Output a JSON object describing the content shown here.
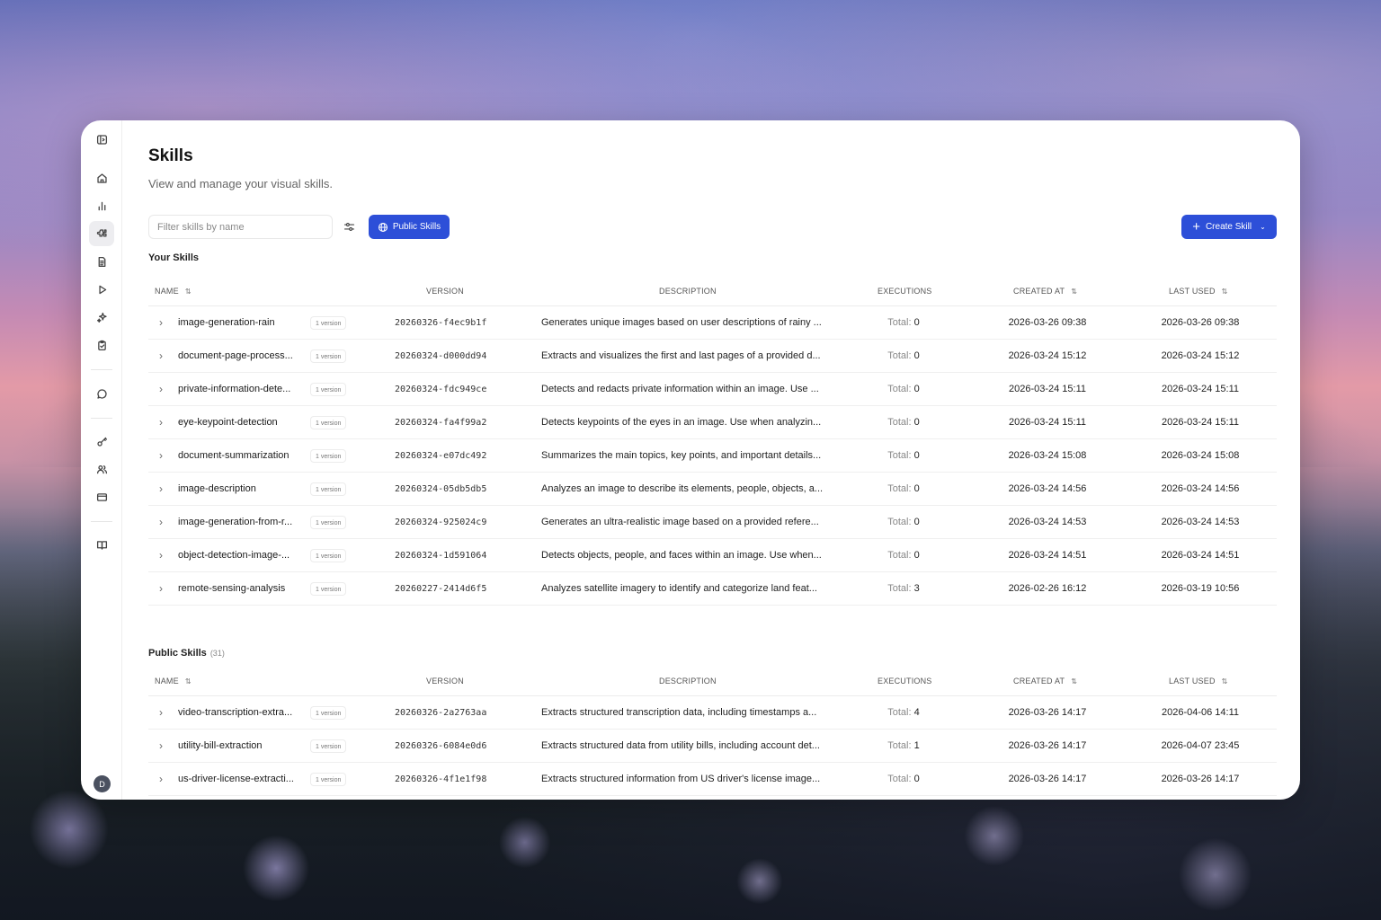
{
  "page": {
    "title": "Skills",
    "subtitle": "View and manage your visual skills."
  },
  "sidebar": {
    "items": [
      {
        "name": "sidebar-toggle",
        "icon": "panel-icon"
      },
      {
        "name": "home",
        "icon": "home-icon"
      },
      {
        "name": "analytics",
        "icon": "bar-chart-icon"
      },
      {
        "name": "skills",
        "icon": "puzzle-icon",
        "active": true
      },
      {
        "name": "documents",
        "icon": "document-icon"
      },
      {
        "name": "runs",
        "icon": "play-icon"
      },
      {
        "name": "sparkles",
        "icon": "sparkles-icon"
      },
      {
        "name": "tasks",
        "icon": "clipboard-icon"
      },
      {
        "name": "chat",
        "icon": "chat-icon"
      },
      {
        "name": "api-keys",
        "icon": "key-icon"
      },
      {
        "name": "team",
        "icon": "users-icon"
      },
      {
        "name": "billing",
        "icon": "credit-card-icon"
      },
      {
        "name": "docs",
        "icon": "book-icon"
      }
    ],
    "avatar": "D"
  },
  "toolbar": {
    "filter_placeholder": "Filter skills by name",
    "public_skills_label": "Public Skills",
    "create_skill_label": "Create Skill",
    "accent": "#2d4fd8"
  },
  "columns": {
    "name": "NAME",
    "version": "VERSION",
    "description": "DESCRIPTION",
    "executions": "EXECUTIONS",
    "created_at": "CREATED AT",
    "last_used": "LAST USED"
  },
  "your_skills": {
    "title": "Your Skills",
    "rows": [
      {
        "name": "image-generation-rain",
        "badge": "1 version",
        "version": "20260326-f4ec9b1f",
        "description": "Generates unique images based on user descriptions of rainy ...",
        "exec_label": "Total:",
        "exec_value": "0",
        "created": "2026-03-26 09:38",
        "last_used": "2026-03-26 09:38"
      },
      {
        "name": "document-page-process...",
        "badge": "1 version",
        "version": "20260324-d000dd94",
        "description": "Extracts and visualizes the first and last pages of a provided d...",
        "exec_label": "Total:",
        "exec_value": "0",
        "created": "2026-03-24 15:12",
        "last_used": "2026-03-24 15:12"
      },
      {
        "name": "private-information-dete...",
        "badge": "1 version",
        "version": "20260324-fdc949ce",
        "description": "Detects and redacts private information within an image. Use ...",
        "exec_label": "Total:",
        "exec_value": "0",
        "created": "2026-03-24 15:11",
        "last_used": "2026-03-24 15:11"
      },
      {
        "name": "eye-keypoint-detection",
        "badge": "1 version",
        "version": "20260324-fa4f99a2",
        "description": "Detects keypoints of the eyes in an image. Use when analyzin...",
        "exec_label": "Total:",
        "exec_value": "0",
        "created": "2026-03-24 15:11",
        "last_used": "2026-03-24 15:11"
      },
      {
        "name": "document-summarization",
        "badge": "1 version",
        "version": "20260324-e07dc492",
        "description": "Summarizes the main topics, key points, and important details...",
        "exec_label": "Total:",
        "exec_value": "0",
        "created": "2026-03-24 15:08",
        "last_used": "2026-03-24 15:08"
      },
      {
        "name": "image-description",
        "badge": "1 version",
        "version": "20260324-05db5db5",
        "description": "Analyzes an image to describe its elements, people, objects, a...",
        "exec_label": "Total:",
        "exec_value": "0",
        "created": "2026-03-24 14:56",
        "last_used": "2026-03-24 14:56"
      },
      {
        "name": "image-generation-from-r...",
        "badge": "1 version",
        "version": "20260324-925024c9",
        "description": "Generates an ultra-realistic image based on a provided refere...",
        "exec_label": "Total:",
        "exec_value": "0",
        "created": "2026-03-24 14:53",
        "last_used": "2026-03-24 14:53"
      },
      {
        "name": "object-detection-image-...",
        "badge": "1 version",
        "version": "20260324-1d591064",
        "description": "Detects objects, people, and faces within an image. Use when...",
        "exec_label": "Total:",
        "exec_value": "0",
        "created": "2026-03-24 14:51",
        "last_used": "2026-03-24 14:51"
      },
      {
        "name": "remote-sensing-analysis",
        "badge": "1 version",
        "version": "20260227-2414d6f5",
        "description": "Analyzes satellite imagery to identify and categorize land feat...",
        "exec_label": "Total:",
        "exec_value": "3",
        "created": "2026-02-26 16:12",
        "last_used": "2026-03-19 10:56"
      }
    ]
  },
  "public_skills": {
    "title": "Public Skills",
    "count": "(31)",
    "rows": [
      {
        "name": "video-transcription-extra...",
        "badge": "1 version",
        "version": "20260326-2a2763aa",
        "description": "Extracts structured transcription data, including timestamps a...",
        "exec_label": "Total:",
        "exec_value": "4",
        "created": "2026-03-26 14:17",
        "last_used": "2026-04-06 14:11"
      },
      {
        "name": "utility-bill-extraction",
        "badge": "1 version",
        "version": "20260326-6084e0d6",
        "description": "Extracts structured data from utility bills, including account det...",
        "exec_label": "Total:",
        "exec_value": "1",
        "created": "2026-03-26 14:17",
        "last_used": "2026-04-07 23:45"
      },
      {
        "name": "us-driver-license-extracti...",
        "badge": "1 version",
        "version": "20260326-4f1e1f98",
        "description": "Extracts structured information from US driver's license image...",
        "exec_label": "Total:",
        "exec_value": "0",
        "created": "2026-03-26 14:17",
        "last_used": "2026-03-26 14:17"
      }
    ]
  }
}
